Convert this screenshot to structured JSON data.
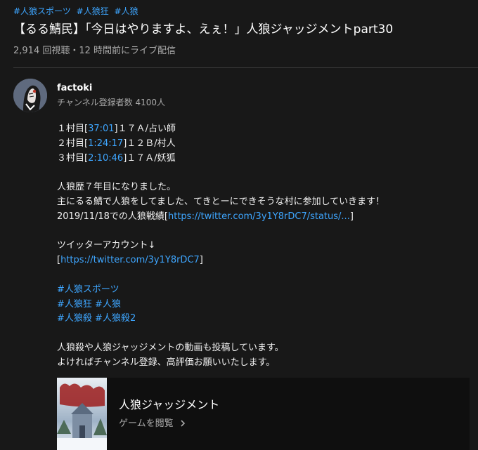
{
  "hashtags": [
    "#人狼スポーツ",
    "#人狼狂",
    "#人狼"
  ],
  "video": {
    "title": "【るる鯖民】「今日はやりますよ、えぇ！」人狼ジャッジメントpart30",
    "meta": "2,914 回視聴・12 時間前にライブ配信"
  },
  "channel": {
    "name": "factoki",
    "subscribers": "チャンネル登録者数 4100人"
  },
  "description": {
    "chapters": [
      {
        "prefix": "１村目[",
        "time": "37:01",
        "suffix": "]１７Ａ/占い師"
      },
      {
        "prefix": "２村目[",
        "time": "1:24:17",
        "suffix": "]１２Ｂ/村人"
      },
      {
        "prefix": "３村目[",
        "time": "2:10:46",
        "suffix": "]１７Ａ/妖狐"
      }
    ],
    "intro1": "人狼歴７年目になりました。",
    "intro2": "主にるる鯖で人狼をしてました、てきとーにできそうな村に参加していきます！",
    "record_prefix": "2019/11/18での人狼戦績[",
    "record_link": "https://twitter.com/3y1Y8rDC7/status/...",
    "record_suffix": "]",
    "twitter_label": "ツイッターアカウント↓",
    "twitter_prefix": "[",
    "twitter_link": "https://twitter.com/3y1Y8rDC7",
    "twitter_suffix": "]",
    "tag_lines": [
      [
        "#人狼スポーツ"
      ],
      [
        "#人狼狂",
        "#人狼"
      ],
      [
        "#人狼殺",
        "#人狼殺2"
      ]
    ],
    "outro1": "人狼殺や人狼ジャッジメントの動画も投稿しています。",
    "outro2": "よければチャンネル登録、高評価お願いいたします。"
  },
  "game": {
    "title": "人狼ジャッジメント",
    "browse_label": "ゲームを閲覧",
    "browse_icon": "chevron-right-icon"
  },
  "colors": {
    "background": "#181818",
    "link": "#3ea6ff",
    "secondary_text": "#aaaaaa",
    "card_background": "#0f0f0f"
  }
}
